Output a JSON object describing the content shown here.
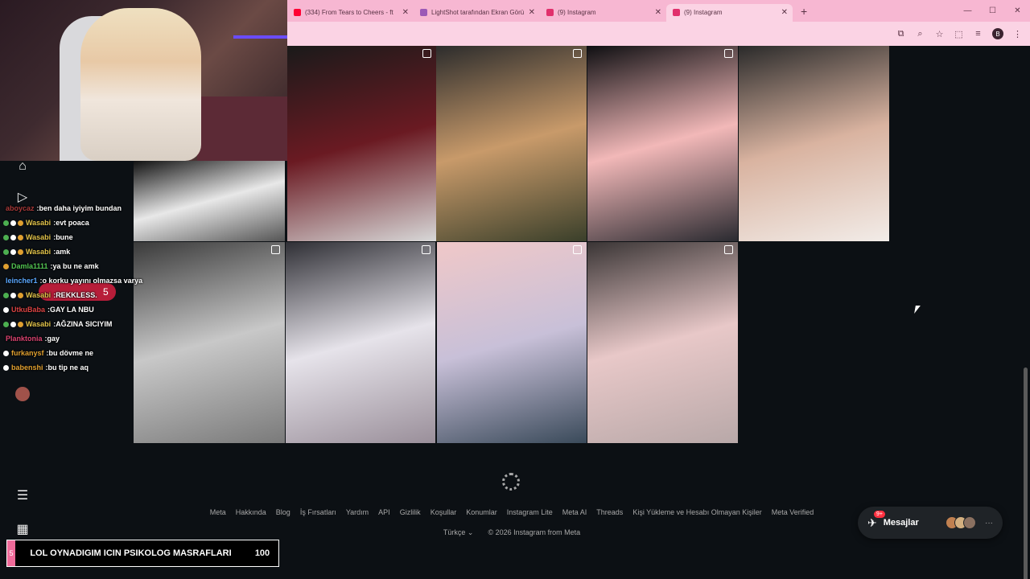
{
  "browser": {
    "tabs": [
      {
        "title": "(334) From Tears to Cheers - ft",
        "favicon_color": "#ff0033",
        "active": false
      },
      {
        "title": "LightShot tarafından Ekran Görü",
        "favicon_color": "#9b59b6",
        "active": false
      },
      {
        "title": "(9) Instagram",
        "favicon_color": "#e1306c",
        "active": false
      },
      {
        "title": "(9) Instagram",
        "favicon_color": "#e1306c",
        "active": true
      }
    ],
    "new_tab": "+",
    "window_controls": [
      "—",
      "☐",
      "✕"
    ],
    "profile_letter": "B",
    "toolbar_icons": [
      "install-icon",
      "zoom-icon",
      "bookmark-star-icon",
      "extensions-icon",
      "reading-list-icon",
      "menu-icon"
    ]
  },
  "chat": {
    "messages": [
      {
        "user": "aboycaz",
        "text": "ben daha iyiyim bundan",
        "user_color": "#a83a3a",
        "badges": []
      },
      {
        "user": "Wasabi",
        "text": "evt poaca",
        "user_color": "#e0c24a",
        "badges": [
          "#4caf50",
          "#ffffff",
          "#e0a030"
        ]
      },
      {
        "user": "Wasabi",
        "text": "bune",
        "user_color": "#e0c24a",
        "badges": [
          "#4caf50",
          "#ffffff",
          "#e0a030"
        ]
      },
      {
        "user": "Wasabi",
        "text": "amk",
        "user_color": "#e0c24a",
        "badges": [
          "#4caf50",
          "#ffffff",
          "#e0a030"
        ]
      },
      {
        "user": "Damla1111",
        "text": "ya bu ne amk",
        "user_color": "#53c653",
        "badges": [
          "#e0a030"
        ]
      },
      {
        "user": "leincher1",
        "text": "o korku yayını olmazsa varya",
        "user_color": "#5aa8ff",
        "badges": []
      },
      {
        "user": "Wasabi",
        "text": "REKKLESS.",
        "user_color": "#e0c24a",
        "badges": [
          "#4caf50",
          "#ffffff",
          "#e0a030"
        ]
      },
      {
        "user": "UtkuBaba",
        "text": "GAY LA NBU",
        "user_color": "#d94343",
        "badges": [
          "#ffffff"
        ]
      },
      {
        "user": "Wasabi",
        "text": "AĞZINA SICIYIM",
        "user_color": "#e0c24a",
        "badges": [
          "#4caf50",
          "#ffffff",
          "#e0a030"
        ]
      },
      {
        "user": "Planktonia",
        "text": "gay",
        "user_color": "#d94370",
        "badges": []
      },
      {
        "user": "furkanysf",
        "text": "bu dövme ne",
        "user_color": "#e0a030",
        "badges": [
          "#ffffff"
        ]
      },
      {
        "user": "babenshi",
        "text": "bu tip ne aq",
        "user_color": "#e0a030",
        "badges": [
          "#ffffff"
        ]
      }
    ],
    "notification_count": "5"
  },
  "posts": [
    {
      "id": "post-wine",
      "colors": [
        "#1a1a1a",
        "#6a1a22",
        "#d8d8d8"
      ],
      "multi": true
    },
    {
      "id": "post-selfie-bed",
      "colors": [
        "#2c2c2c",
        "#c89a6a",
        "#3a3f2a"
      ],
      "multi": true
    },
    {
      "id": "post-perfume",
      "colors": [
        "#0f0f12",
        "#f2b8b8",
        "#2a2a30"
      ],
      "multi": true
    },
    {
      "id": "post-portrait",
      "colors": [
        "#2a2a2a",
        "#d9b3a0",
        "#f2ece8"
      ],
      "multi": false
    },
    {
      "id": "post-boots",
      "colors": [
        "#111111",
        "#e8e8e8",
        "#555555"
      ],
      "multi": false
    },
    {
      "id": "post-shelves",
      "colors": [
        "#3a3a3a",
        "#c8c8c8",
        "#7a7a7a"
      ],
      "multi": true
    },
    {
      "id": "post-mirror-dress",
      "colors": [
        "#2f2f35",
        "#e6e3ea",
        "#9a8f9a"
      ],
      "multi": true
    },
    {
      "id": "post-sunset-sea",
      "colors": [
        "#f0c8c8",
        "#c8c0d8",
        "#3a4a5a"
      ],
      "multi": true
    },
    {
      "id": "post-mirror-pink",
      "colors": [
        "#3a3535",
        "#e8c8c8",
        "#b8a8a8"
      ],
      "multi": true
    }
  ],
  "footer": {
    "links": [
      "Meta",
      "Hakkında",
      "Blog",
      "İş Fırsatları",
      "Yardım",
      "API",
      "Gizlilik",
      "Koşullar",
      "Konumlar",
      "Instagram Lite",
      "Meta AI",
      "Threads",
      "Kişi Yükleme ve Hesabı Olmayan Kişiler",
      "Meta Verified"
    ],
    "language": "Türkçe",
    "copyright": "© 2026 Instagram from Meta"
  },
  "messages": {
    "label": "Mesajlar",
    "badge": "9+",
    "avatars": [
      "#c08050",
      "#d4b080",
      "#8a7060"
    ],
    "more": "···"
  },
  "goal": {
    "current": "5",
    "text": "LOL OYNADIGIM ICIN PSIKOLOG MASRAFLARI",
    "target": "100",
    "progress_fraction": 0.05
  },
  "sidebar": {
    "icons": [
      "home-icon",
      "video-icon",
      "heart-icon",
      "add-icon",
      "messenger-icon",
      "profile-avatar-icon",
      "menu-icon",
      "apps-icon"
    ]
  }
}
